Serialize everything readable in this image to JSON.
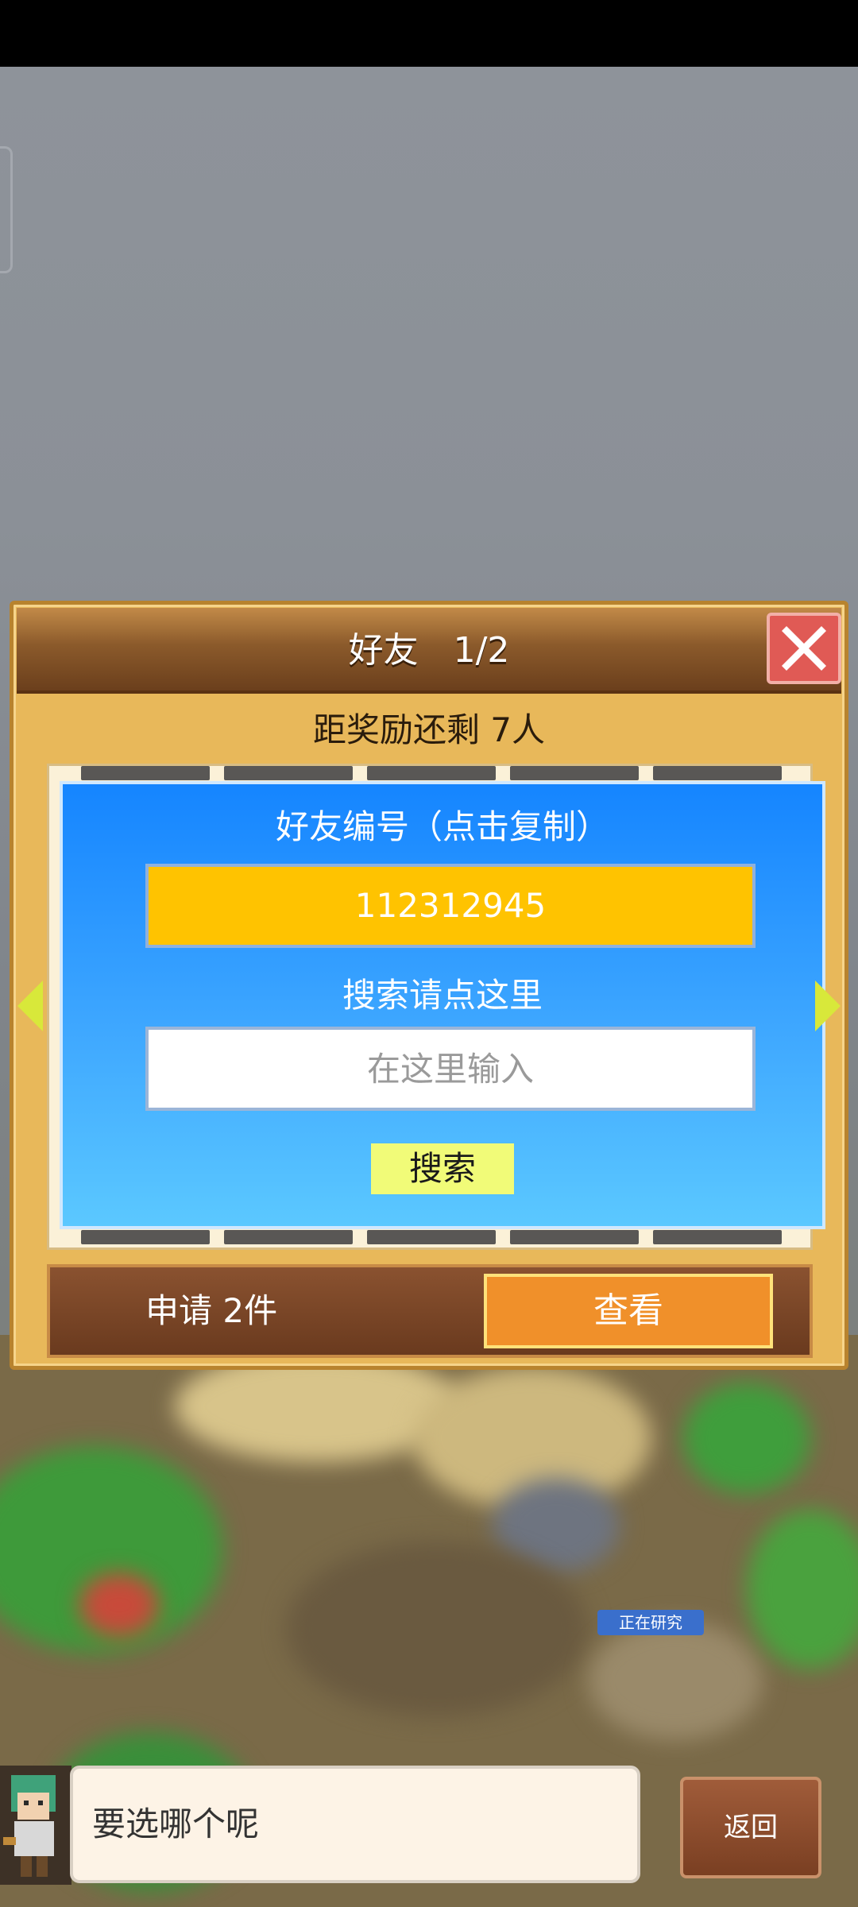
{
  "panel": {
    "title": "好友　1/2",
    "reward_line": "距奖励还剩 7人"
  },
  "friend_card": {
    "id_label": "好友编号（点击复制）",
    "friend_id": "112312945",
    "search_label": "搜索请点这里",
    "search_placeholder": "在这里输入",
    "search_button": "搜索"
  },
  "requests": {
    "text": "申请 2件",
    "view_button": "查看"
  },
  "background": {
    "research_badge": "正在研究"
  },
  "dialog": {
    "text": "要选哪个呢",
    "back_button": "返回"
  },
  "icons": {
    "close": "close-icon",
    "prev": "arrow-left-icon",
    "next": "arrow-right-icon"
  },
  "colors": {
    "panel_wood": "#e8b85a",
    "header_brown": "#6b3f1c",
    "card_blue": "#1585ff",
    "id_yellow": "#ffc300",
    "search_btn": "#f1fb78",
    "view_btn_orange": "#f0902a",
    "close_red": "#e05a55"
  }
}
